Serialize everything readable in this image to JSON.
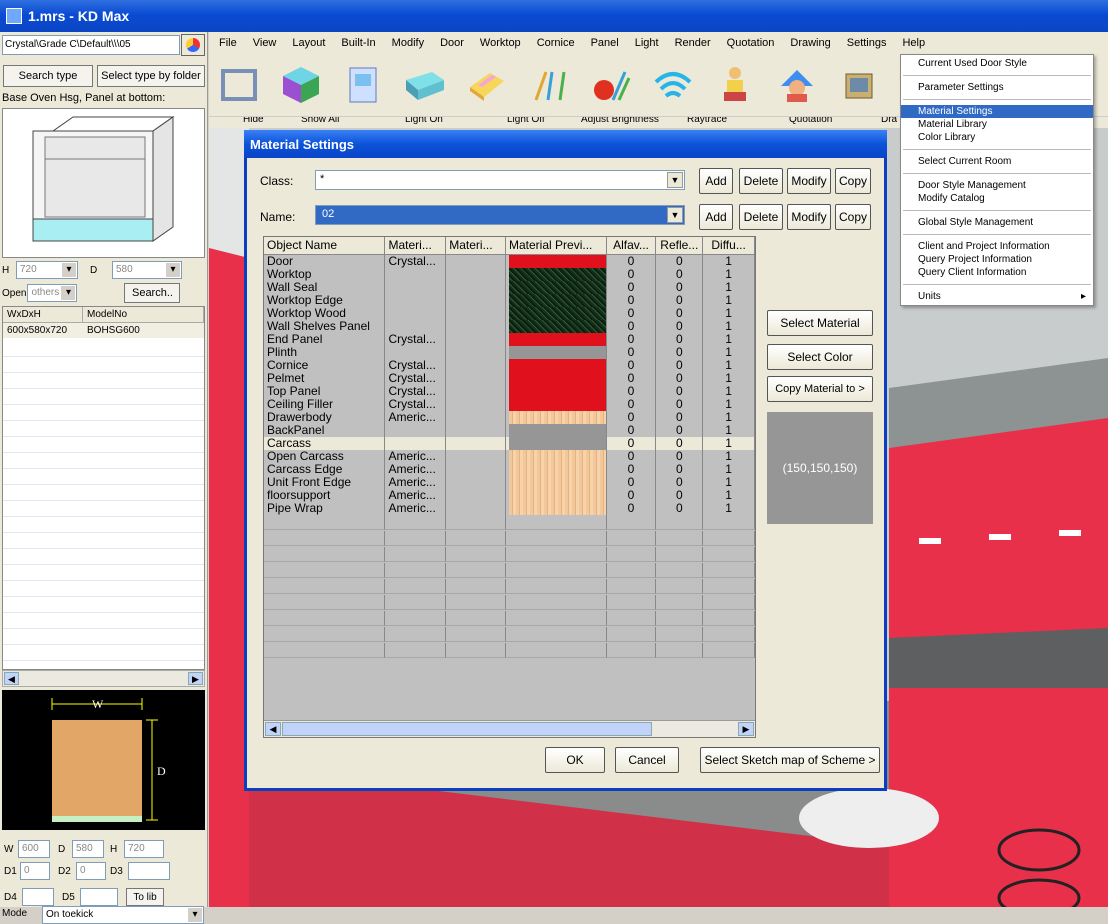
{
  "window": {
    "title": "1.mrs - KD Max"
  },
  "left_panel": {
    "path": "Crystal\\Grade C\\Default\\\\\\05",
    "search_type": "Search type",
    "select_by_folder": "Select type by folder",
    "caption": "Base Oven Hsg, Panel at bottom:",
    "h_label": "H",
    "h_value": "720",
    "d_label": "D",
    "d_value": "580",
    "open_label": "Open",
    "open_value": "others c",
    "search_btn": "Search..",
    "list_headers": [
      "WxDxH",
      "ModelNo"
    ],
    "list_rows": [
      [
        "600x580x720",
        "BOHSG600"
      ]
    ],
    "dim_w": "W",
    "dim_d": "D",
    "w_label": "W",
    "w_value": "600",
    "d2_label": "D",
    "d2_value": "580",
    "h2_label": "H",
    "h2_value": "720",
    "d1_label": "D1",
    "d1_value": "0",
    "d2b_label": "D2",
    "d2b_value": "0",
    "d3_label": "D3",
    "d4_label": "D4",
    "d5_label": "D5",
    "to_lib": "To lib",
    "mode_label": "Mode",
    "mode_value": "On toekick"
  },
  "menu": [
    "File",
    "View",
    "Layout",
    "Built-In",
    "Modify",
    "Door",
    "Worktop",
    "Cornice",
    "Panel",
    "Light",
    "Render",
    "Quotation",
    "Drawing",
    "Settings",
    "Help"
  ],
  "subtoolbar": [
    "Hide",
    "Show All",
    "Light On",
    "Light Off",
    "Adjust Brightness",
    "Raytrace",
    "Quotation",
    "Dra"
  ],
  "settings_menu": [
    {
      "label": "Current Used Door Style"
    },
    {
      "sep": true
    },
    {
      "label": "Parameter Settings"
    },
    {
      "sep": true
    },
    {
      "label": "Material Settings",
      "selected": true
    },
    {
      "label": "Material Library"
    },
    {
      "label": "Color Library"
    },
    {
      "sep": true
    },
    {
      "label": "Select Current Room"
    },
    {
      "sep": true
    },
    {
      "label": "Door Style Management"
    },
    {
      "label": "Modify Catalog"
    },
    {
      "sep": true
    },
    {
      "label": "Global Style Management"
    },
    {
      "sep": true
    },
    {
      "label": "Client and Project Information"
    },
    {
      "label": "Query Project Information"
    },
    {
      "label": "Query Client Information"
    },
    {
      "sep": true
    },
    {
      "label": "Units",
      "submenu": true
    }
  ],
  "dialog": {
    "title": "Material Settings",
    "class_label": "Class:",
    "class_value": "*",
    "name_label": "Name:",
    "name_value": "02",
    "add": "Add",
    "delete": "Delete",
    "modify": "Modify",
    "copy": "Copy",
    "columns": [
      "Object Name",
      "Materi...",
      "Materi...",
      "Material Previ...",
      "Alfav...",
      "Refle...",
      "Diffu..."
    ],
    "rows": [
      {
        "name": "Door",
        "mat1": "Crystal...",
        "mat2": "",
        "preview": "red",
        "alfa": "0",
        "refl": "0",
        "diff": "1"
      },
      {
        "name": "Worktop",
        "mat1": "",
        "mat2": "",
        "preview": "granite",
        "alfa": "0",
        "refl": "0",
        "diff": "1"
      },
      {
        "name": "Wall Seal",
        "mat1": "",
        "mat2": "",
        "preview": "granite",
        "alfa": "0",
        "refl": "0",
        "diff": "1"
      },
      {
        "name": "Worktop Edge",
        "mat1": "",
        "mat2": "",
        "preview": "granite",
        "alfa": "0",
        "refl": "0",
        "diff": "1"
      },
      {
        "name": "Worktop Wood",
        "mat1": "",
        "mat2": "",
        "preview": "granite",
        "alfa": "0",
        "refl": "0",
        "diff": "1"
      },
      {
        "name": "Wall Shelves Panel",
        "mat1": "",
        "mat2": "",
        "preview": "granite",
        "alfa": "0",
        "refl": "0",
        "diff": "1"
      },
      {
        "name": "End Panel",
        "mat1": "Crystal...",
        "mat2": "",
        "preview": "red",
        "alfa": "0",
        "refl": "0",
        "diff": "1"
      },
      {
        "name": "Plinth",
        "mat1": "",
        "mat2": "",
        "preview": "grey",
        "alfa": "0",
        "refl": "0",
        "diff": "1"
      },
      {
        "name": "Cornice",
        "mat1": "Crystal...",
        "mat2": "",
        "preview": "red",
        "alfa": "0",
        "refl": "0",
        "diff": "1"
      },
      {
        "name": "Pelmet",
        "mat1": "Crystal...",
        "mat2": "",
        "preview": "red",
        "alfa": "0",
        "refl": "0",
        "diff": "1"
      },
      {
        "name": "Top Panel",
        "mat1": "Crystal...",
        "mat2": "",
        "preview": "red",
        "alfa": "0",
        "refl": "0",
        "diff": "1"
      },
      {
        "name": "Ceiling Filler",
        "mat1": "Crystal...",
        "mat2": "",
        "preview": "red",
        "alfa": "0",
        "refl": "0",
        "diff": "1"
      },
      {
        "name": "Drawerbody",
        "mat1": "Americ...",
        "mat2": "",
        "preview": "wood",
        "alfa": "0",
        "refl": "0",
        "diff": "1"
      },
      {
        "name": "BackPanel",
        "mat1": "",
        "mat2": "",
        "preview": "grey",
        "alfa": "0",
        "refl": "0",
        "diff": "1"
      },
      {
        "name": "Carcass",
        "mat1": "",
        "mat2": "",
        "preview": "grey",
        "alfa": "0",
        "refl": "0",
        "diff": "1",
        "highlight": true
      },
      {
        "name": "Open Carcass",
        "mat1": "Americ...",
        "mat2": "",
        "preview": "wood",
        "alfa": "0",
        "refl": "0",
        "diff": "1"
      },
      {
        "name": "Carcass Edge",
        "mat1": "Americ...",
        "mat2": "",
        "preview": "wood",
        "alfa": "0",
        "refl": "0",
        "diff": "1"
      },
      {
        "name": "Unit Front Edge",
        "mat1": "Americ...",
        "mat2": "",
        "preview": "wood",
        "alfa": "0",
        "refl": "0",
        "diff": "1"
      },
      {
        "name": "floorsupport",
        "mat1": "Americ...",
        "mat2": "",
        "preview": "wood",
        "alfa": "0",
        "refl": "0",
        "diff": "1"
      },
      {
        "name": "Pipe Wrap",
        "mat1": "Americ...",
        "mat2": "",
        "preview": "wood",
        "alfa": "0",
        "refl": "0",
        "diff": "1"
      }
    ],
    "select_material": "Select Material",
    "select_color": "Select Color",
    "copy_material_to": "Copy Material to >",
    "color_value": "(150,150,150)",
    "ok": "OK",
    "cancel": "Cancel",
    "select_sketch": "Select Sketch map of Scheme >"
  },
  "colors": {
    "red": "#e0101c",
    "grey": "#969696",
    "wood": "#f2c79a",
    "granite": "#1f3a22",
    "kitchen_red": "#e8304a",
    "title_blue": "#0b53d8"
  }
}
